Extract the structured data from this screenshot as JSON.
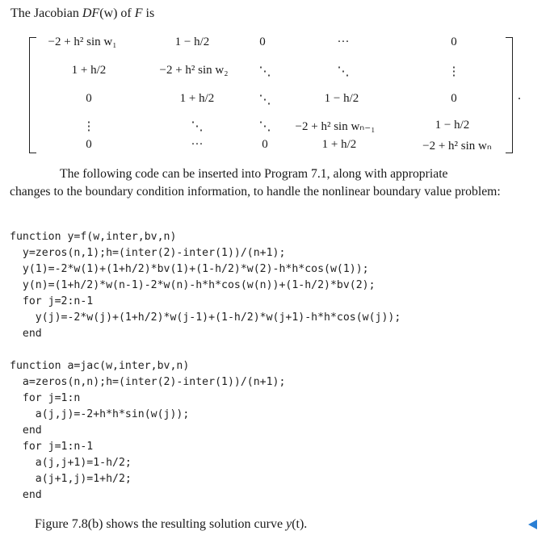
{
  "intro": {
    "prefix": "The Jacobian ",
    "DF": "DF",
    "arg": "(w)",
    "mid": " of ",
    "F": "F",
    "suffix": " is"
  },
  "matrix": {
    "r1": [
      "−2 + h² sin w₁",
      "1 − h/2",
      "0",
      "···",
      "0"
    ],
    "r2": [
      "1 + h/2",
      "−2 + h² sin w₂",
      "⋱",
      "⋱",
      "⋮"
    ],
    "r3": [
      "0",
      "1 + h/2",
      "⋱",
      "1 − h/2",
      "0"
    ],
    "r4": [
      "⋮",
      "⋱",
      "⋱",
      "−2 + h² sin wₙ₋₁",
      "1 − h/2"
    ],
    "r5": [
      "0",
      "···",
      "0",
      "1 + h/2",
      "−2 + h² sin wₙ"
    ],
    "period": "."
  },
  "paragraph": {
    "line1": "The following code can be inserted into Program 7.1, along with appropriate",
    "rest": "changes to the boundary condition information, to handle the nonlinear boundary value problem:"
  },
  "code1": "function y=f(w,inter,bv,n)\n  y=zeros(n,1);h=(inter(2)-inter(1))/(n+1);\n  y(1)=-2*w(1)+(1+h/2)*bv(1)+(1-h/2)*w(2)-h*h*cos(w(1));\n  y(n)=(1+h/2)*w(n-1)-2*w(n)-h*h*cos(w(n))+(1-h/2)*bv(2);\n  for j=2:n-1\n    y(j)=-2*w(j)+(1+h/2)*w(j-1)+(1-h/2)*w(j+1)-h*h*cos(w(j));\n  end",
  "code2": "function a=jac(w,inter,bv,n)\n  a=zeros(n,n);h=(inter(2)-inter(1))/(n+1);\n  for j=1:n\n    a(j,j)=-2+h*h*sin(w(j));\n  end\n  for j=1:n-1\n    a(j,j+1)=1-h/2;\n    a(j+1,j)=1+h/2;\n  end",
  "caption": {
    "prefix": "Figure 7.8(b) shows the resulting solution curve ",
    "y": "y",
    "t": "(t)."
  },
  "colors": {
    "nav_arrow": "#2a7fd4"
  },
  "icons": {
    "nav": "back-arrow-icon"
  }
}
